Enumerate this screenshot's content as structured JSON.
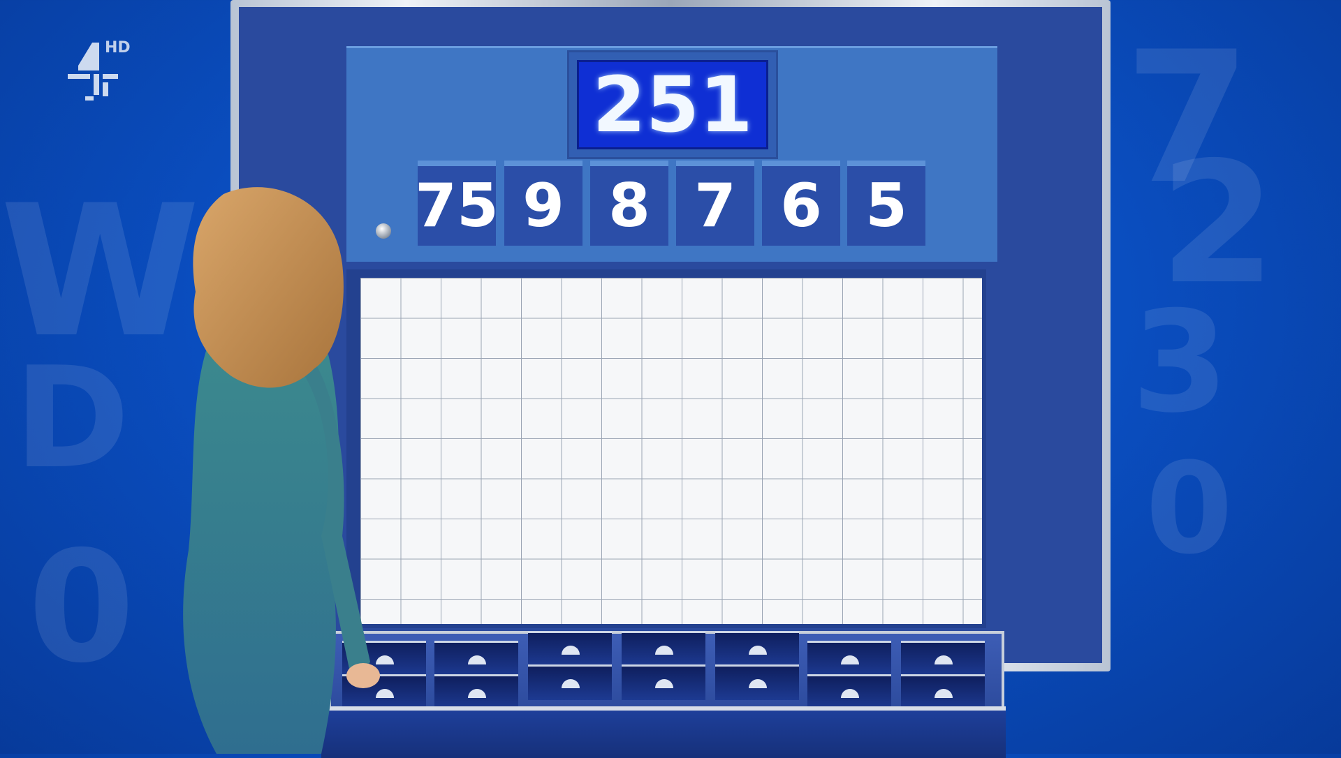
{
  "channel": {
    "logo_icon": "channel-4-logo",
    "hd_label": "HD"
  },
  "game": {
    "target": "251",
    "numbers": [
      "75",
      "9",
      "8",
      "7",
      "6",
      "5"
    ]
  },
  "colors": {
    "background": "#0a4fc2",
    "board": "#2a4a9e",
    "top_panel": "#3f76c4",
    "target_screen": "#0f2fd4",
    "tile": "#2b4ea8",
    "whiteboard": "#f6f7f9"
  }
}
